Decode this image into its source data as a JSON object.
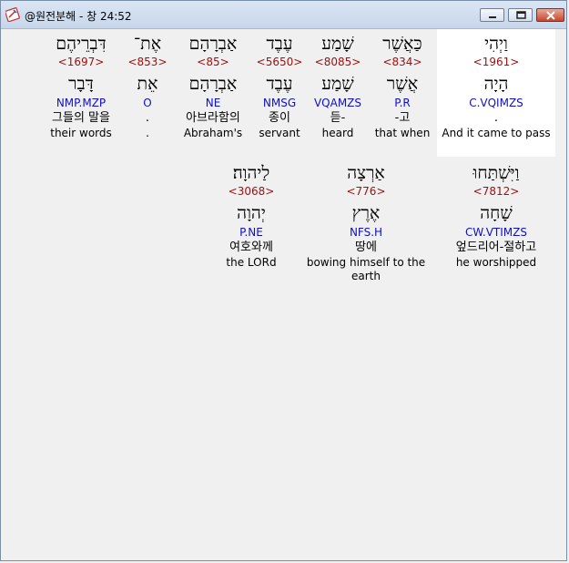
{
  "window": {
    "title": "@원전분해 - 창 24:52",
    "buttons": {
      "minimize": "minimize-icon",
      "maximize": "maximize-icon",
      "close": "close-icon"
    }
  },
  "row1": [
    {
      "heb": "דִּבְרֵיהֶם",
      "strong": "<1697>",
      "lemma": "דָּבָר",
      "morph": "NMP.MZP",
      "kor": "그들의 말을",
      "eng": "their words"
    },
    {
      "heb": "אֶת־",
      "strong": "<853>",
      "lemma": "אֵת",
      "morph": "O",
      "kor": ".",
      "eng": "."
    },
    {
      "heb": "אַבְרָהָם",
      "strong": "<85>",
      "lemma": "אַבְרָהָם",
      "morph": "NE",
      "kor": "아브라함의",
      "eng": "Abraham's"
    },
    {
      "heb": "עֶבֶד",
      "strong": "<5650>",
      "lemma": "עֶבֶד",
      "morph": "NMSG",
      "kor": "종이",
      "eng": "servant"
    },
    {
      "heb": "שָׁמַע",
      "strong": "<8085>",
      "lemma": "שָׁמַע",
      "morph": "VQAMZS",
      "kor": "듣-",
      "eng": "heard"
    },
    {
      "heb": "כַּאֲשֶׁר",
      "strong": "<834>",
      "lemma": "אֲשֶׁר",
      "morph": "P.R",
      "kor": "-고",
      "eng": "that when"
    },
    {
      "heb": "וַיְהִי",
      "strong": "<1961>",
      "lemma": "הָיָה",
      "morph": "C.VQIMZS",
      "kor": ".",
      "eng": "And it came to pass"
    }
  ],
  "row2": [
    {
      "heb": "לַיהוָה׃",
      "strong": "<3068>",
      "lemma": "יְהוָה",
      "morph": "P.NE",
      "kor": "여호와께",
      "eng": "the LORd"
    },
    {
      "heb": "אַרְצָה",
      "strong": "<776>",
      "lemma": "אֶרֶץ",
      "morph": "NFS.H",
      "kor": "땅에",
      "eng": "bowing himself to the earth"
    },
    {
      "heb": "וַיִּשְׁתַּחוּ",
      "strong": "<7812>",
      "lemma": "שָׁחָה",
      "morph": "CW.VTIMZS",
      "kor": "엎드리어-절하고",
      "eng": "he worshipped"
    }
  ]
}
